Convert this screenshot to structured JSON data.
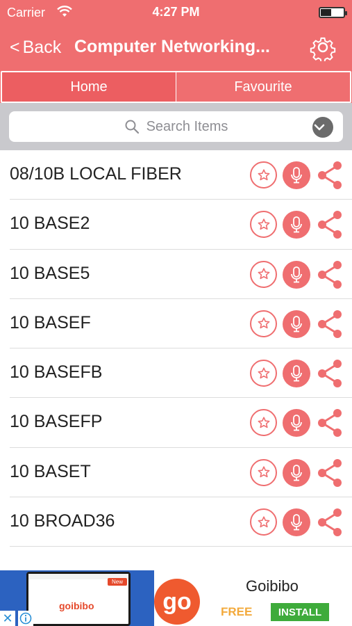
{
  "status_bar": {
    "carrier": "Carrier",
    "time": "4:27 PM"
  },
  "nav": {
    "back_label": "Back",
    "title": "Computer Networking..."
  },
  "tabs": [
    {
      "label": "Home",
      "active": true
    },
    {
      "label": "Favourite",
      "active": false
    }
  ],
  "search": {
    "placeholder": "Search Items"
  },
  "items": [
    {
      "label": "08/10B LOCAL FIBER"
    },
    {
      "label": "10 BASE2"
    },
    {
      "label": "10 BASE5"
    },
    {
      "label": "10 BASEF"
    },
    {
      "label": "10 BASEFB"
    },
    {
      "label": "10 BASEFP"
    },
    {
      "label": "10 BASET"
    },
    {
      "label": "10 BROAD36"
    }
  ],
  "ad": {
    "screenshot_logo": "goibibo",
    "screenshot_badge": "New",
    "logo_text": "go",
    "title": "Goibibo",
    "price": "FREE",
    "cta": "INSTALL"
  },
  "colors": {
    "accent": "#ef6e70",
    "search_bg": "#c9c9cd"
  },
  "icons": {
    "back": "chevron-left-icon",
    "settings": "gear-icon",
    "search": "search-icon",
    "dropdown": "chevron-down-icon",
    "favourite": "star-icon",
    "speak": "microphone-icon",
    "share": "share-icon"
  }
}
